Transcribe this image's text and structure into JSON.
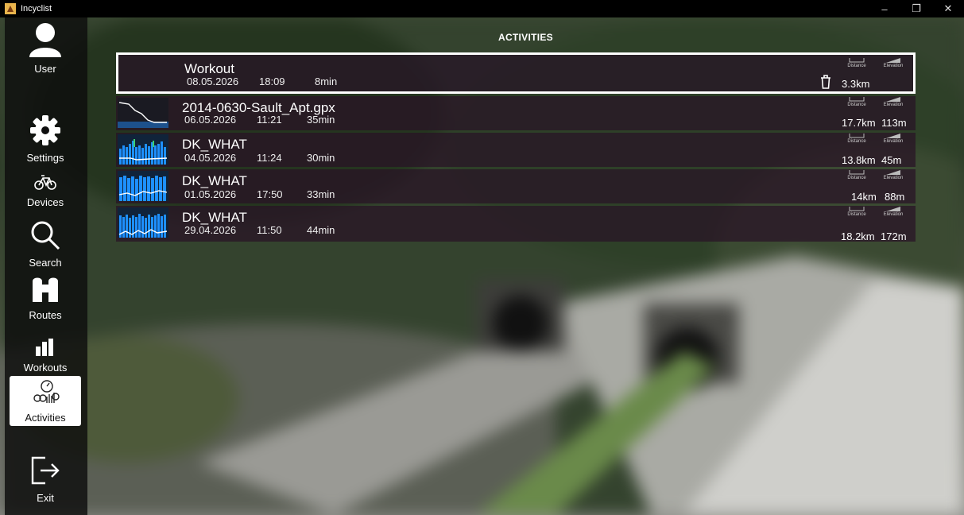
{
  "window": {
    "title": "Incyclist",
    "controls": {
      "minimize": "–",
      "restore": "❐",
      "close": "✕"
    }
  },
  "sidebar": {
    "items": [
      {
        "label": "User",
        "icon": "user-icon"
      },
      {
        "label": "Settings",
        "icon": "gear-icon"
      },
      {
        "label": "Devices",
        "icon": "bicycle-icon"
      },
      {
        "label": "Search",
        "icon": "search-icon"
      },
      {
        "label": "Routes",
        "icon": "routes-icon"
      },
      {
        "label": "Workouts",
        "icon": "workouts-icon"
      },
      {
        "label": "Activities",
        "icon": "activities-icon",
        "active": true
      },
      {
        "label": "Exit",
        "icon": "exit-icon"
      }
    ]
  },
  "page": {
    "title": "ACTIVITIES"
  },
  "stat_labels": {
    "distance": "Distance",
    "elevation": "Elevation"
  },
  "activities": [
    {
      "name": "Workout",
      "date": "08.05.2026",
      "time": "18:09",
      "duration": "8min",
      "distance": "3.3km",
      "elevation": "",
      "selected": true,
      "thumb": "none"
    },
    {
      "name": "2014-0630-Sault_Apt.gpx",
      "date": "06.05.2026",
      "time": "11:21",
      "duration": "35min",
      "distance": "17.7km",
      "elevation": "113m",
      "thumb": "line"
    },
    {
      "name": "DK_WHAT",
      "date": "04.05.2026",
      "time": "11:24",
      "duration": "30min",
      "distance": "13.8km",
      "elevation": "45m",
      "thumb": "bars"
    },
    {
      "name": "DK_WHAT",
      "date": "01.05.2026",
      "time": "17:50",
      "duration": "33min",
      "distance": "14km",
      "elevation": "88m",
      "thumb": "bars"
    },
    {
      "name": "DK_WHAT",
      "date": "29.04.2026",
      "time": "11:50",
      "duration": "44min",
      "distance": "18.2km",
      "elevation": "172m",
      "thumb": "bars"
    }
  ],
  "colors": {
    "row_bg": "#2a1226",
    "accent_blue": "#1e90ff",
    "sidebar_bg": "#0e0e0e"
  }
}
